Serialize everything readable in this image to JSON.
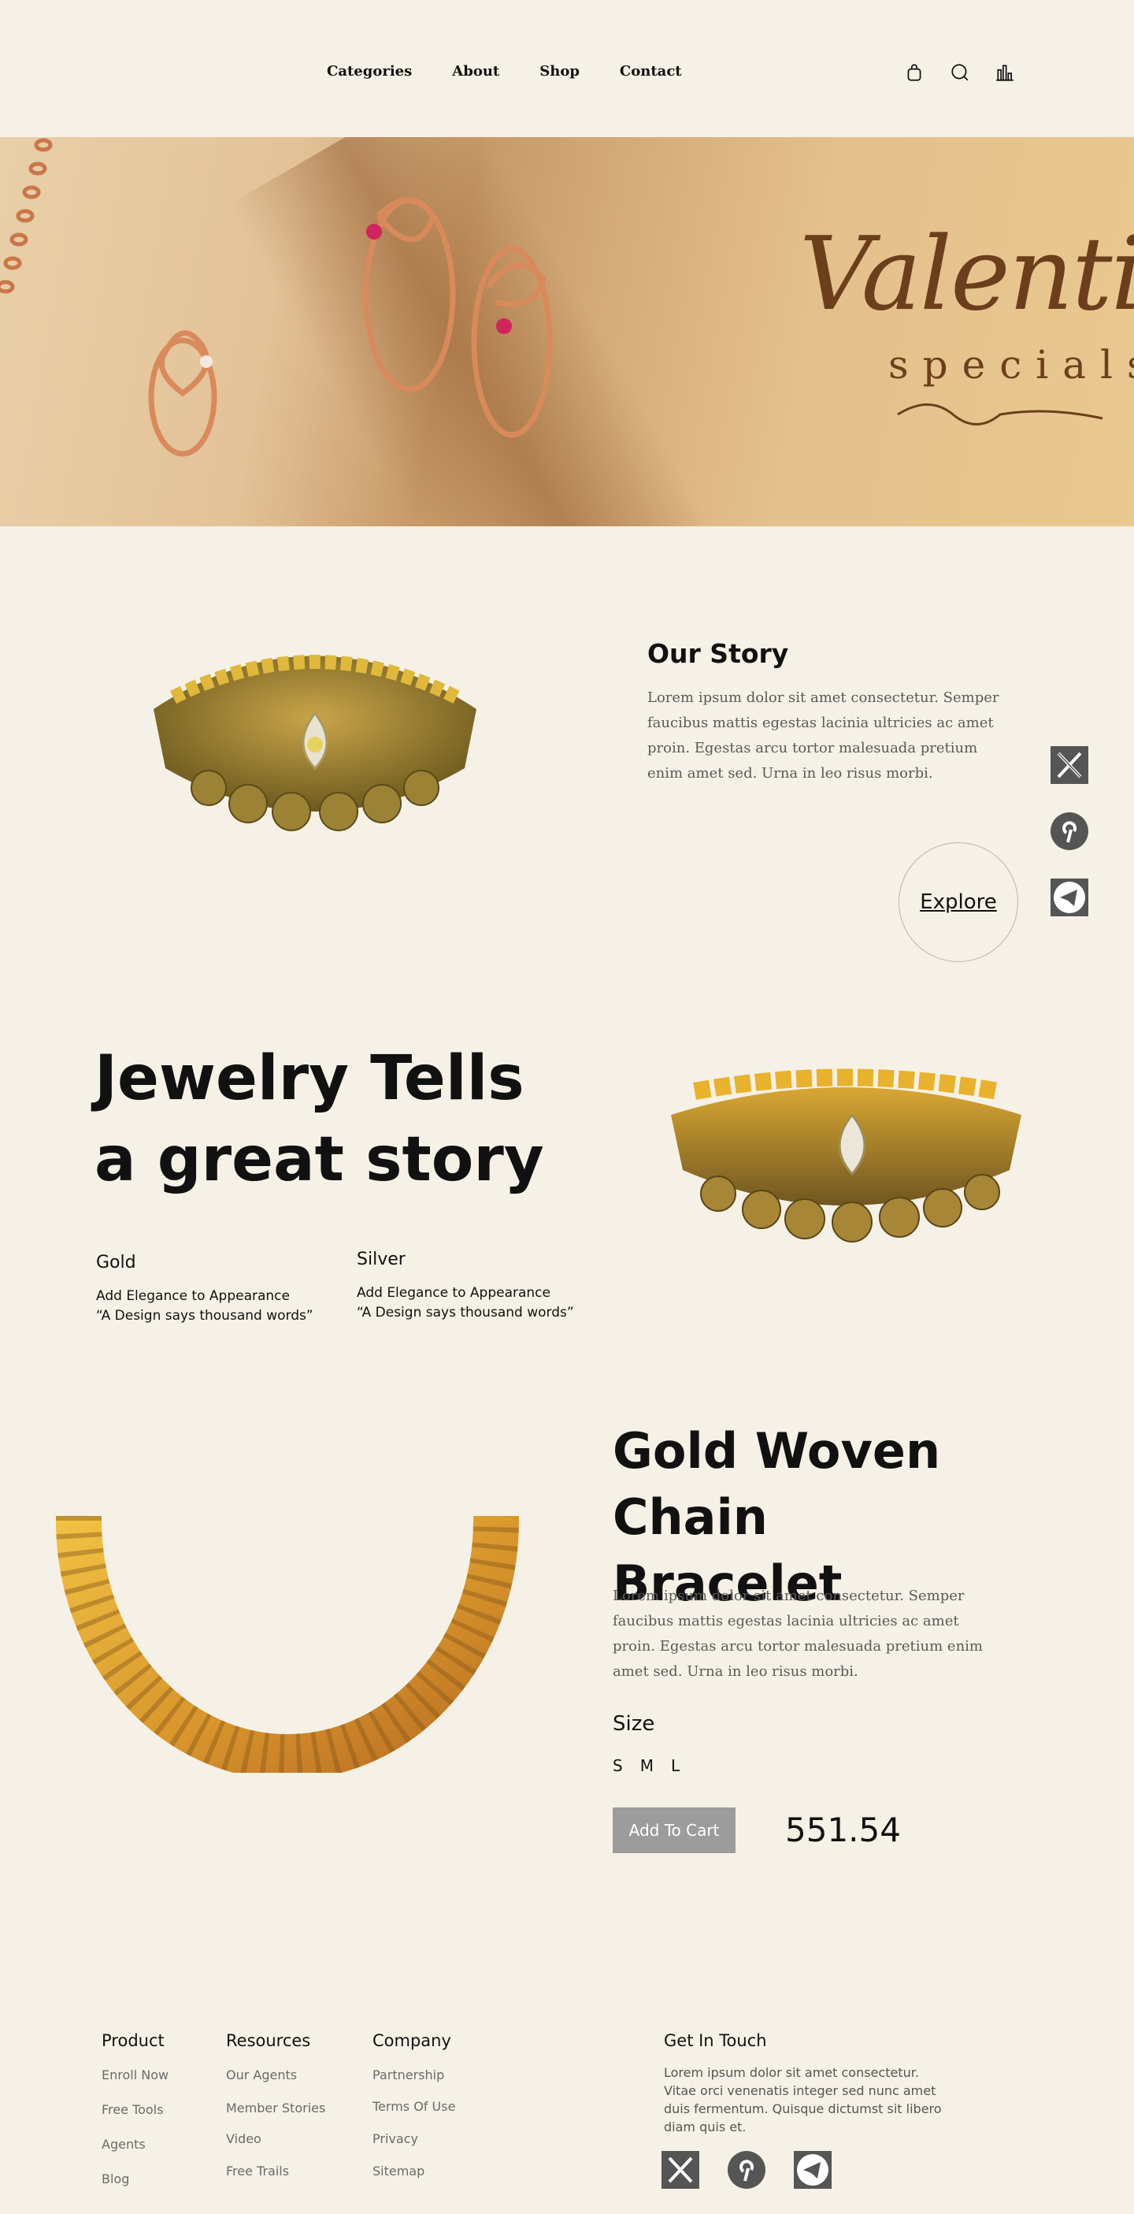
{
  "nav": {
    "links": [
      "Categories",
      "About",
      "Shop",
      "Contact"
    ],
    "icons": [
      "shopping-bag-icon",
      "search-icon",
      "chart-icon"
    ]
  },
  "hero": {
    "script_text": "Valentine",
    "sub_text": "specials"
  },
  "story": {
    "title": "Our Story",
    "text": "Lorem ipsum dolor sit amet consectetur. Semper faucibus mattis egestas lacinia ultricies ac amet proin. Egestas arcu tortor malesuada pretium enim amet sed. Urna in leo risus morbi.",
    "explore_label": "Explore"
  },
  "social": [
    "x-icon",
    "pinterest-icon",
    "telegram-icon"
  ],
  "tells": {
    "title_line1": "Jewelry Tells",
    "title_line2": "a great story",
    "gold": {
      "heading": "Gold",
      "line1": "Add Elegance to Appearance",
      "line2": "“A Design says thousand words”"
    },
    "silver": {
      "heading": "Silver",
      "line1": "Add Elegance to Appearance",
      "line2": "“A Design says thousand words”"
    }
  },
  "product": {
    "title_line1": "Gold Woven Chain",
    "title_line2": "Bracelet",
    "text": "Lorem ipsum dolor sit amet consectetur. Semper faucibus mattis egestas lacinia ultricies ac amet proin. Egestas arcu tortor malesuada pretium enim amet sed. Urna in leo risus morbi.",
    "size_label": "Size",
    "sizes": [
      "S",
      "M",
      "L"
    ],
    "cart_label": "Add To Cart",
    "price": "551.54"
  },
  "footer": {
    "product": {
      "heading": "Product",
      "links": [
        "Enroll Now",
        "Free Tools",
        "Agents",
        "Blog"
      ]
    },
    "resources": {
      "heading": "Resources",
      "links": [
        "Our Agents",
        "Member Stories",
        "Video",
        "Free Trails"
      ]
    },
    "company": {
      "heading": "Company",
      "links": [
        "Partnership",
        "Terms Of Use",
        "Privacy",
        "Sitemap"
      ]
    },
    "contact": {
      "heading": "Get In Touch",
      "text": "Lorem ipsum dolor sit amet consectetur. Vitae orci venenatis integer sed nunc amet duis fermentum. Quisque dictumst sit libero diam quis et."
    }
  }
}
